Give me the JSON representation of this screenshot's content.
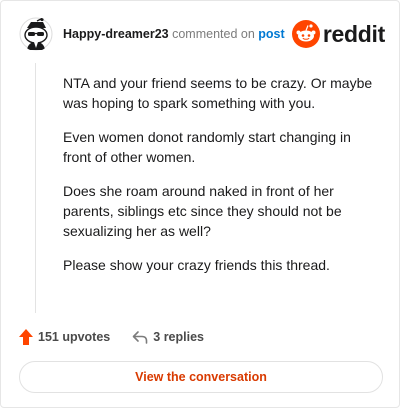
{
  "header": {
    "username": "Happy-dreamer23",
    "action_text": "commented on",
    "post_link": "post",
    "brand_wordmark": "reddit"
  },
  "comment": {
    "paragraphs": [
      "NTA and your friend seems to be crazy. Or maybe was hoping to spark something with you.",
      "Even women donot randomly start changing in front of other women.",
      "Does she roam around naked in front of her parents, siblings etc since they should not be sexualizing her as well?",
      "Please show your crazy friends this thread."
    ]
  },
  "actions": {
    "upvotes_label": "151 upvotes",
    "replies_label": "3 replies"
  },
  "cta": {
    "label": "View the conversation"
  },
  "colors": {
    "brand": "#ff4500",
    "link": "#0079d3",
    "cta_text": "#d93a00"
  },
  "icons": [
    "avatar",
    "reddit-logo-icon",
    "upvote-arrow-icon",
    "reply-icon"
  ]
}
